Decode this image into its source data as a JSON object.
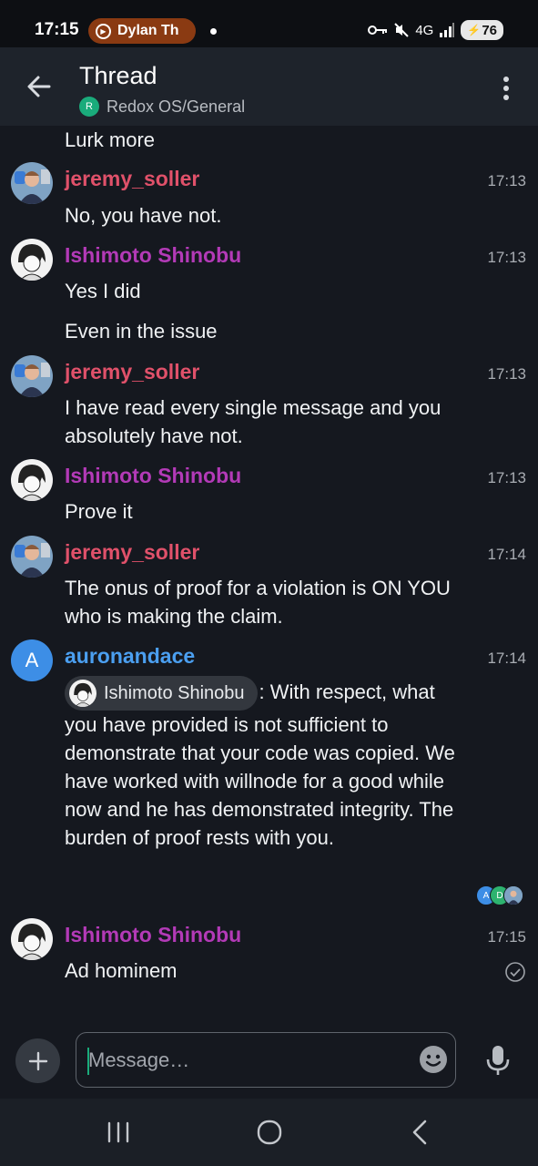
{
  "status_bar": {
    "time": "17:15",
    "pill_text": "Dylan Th",
    "network": "4G",
    "battery": "76",
    "icons": [
      "key-icon",
      "mute-icon",
      "network-icon",
      "signal-icon",
      "battery-icon"
    ]
  },
  "header": {
    "title": "Thread",
    "room_initial": "R",
    "room_path": "Redox OS/General",
    "room_color": "#1aab7b"
  },
  "colors": {
    "jeremy": "#e0516a",
    "ishimoto": "#b33ab7",
    "auron": "#4b9ff0",
    "background": "#15181f"
  },
  "messages": [
    {
      "body": "Lurk more"
    },
    {
      "sender": "jeremy_soller",
      "time": "17:13",
      "body": "No, you have not."
    },
    {
      "sender": "Ishimoto Shinobu",
      "time": "17:13",
      "body": "Yes I did",
      "body2": "Even in the issue"
    },
    {
      "sender": "jeremy_soller",
      "time": "17:13",
      "body": "I have read every single message and you absolutely have not."
    },
    {
      "sender": "Ishimoto Shinobu",
      "time": "17:13",
      "body": "Prove it"
    },
    {
      "sender": "jeremy_soller",
      "time": "17:14",
      "body": "The onus of proof for a violation is ON YOU who is making the claim."
    },
    {
      "sender": "auronandace",
      "avatar_letter": "A",
      "time": "17:14",
      "mention": "Ishimoto Shinobu",
      "body": ": With respect, what you have provided is not sufficient to demonstrate that your code was copied. We have worked with willnode for a good while now and he has demonstrated integrity. The burden of proof rests with you.",
      "receipts": [
        "A",
        "D"
      ]
    },
    {
      "sender": "Ishimoto Shinobu",
      "time": "17:15",
      "body": "Ad hominem"
    }
  ],
  "composer": {
    "placeholder": "Message…"
  }
}
